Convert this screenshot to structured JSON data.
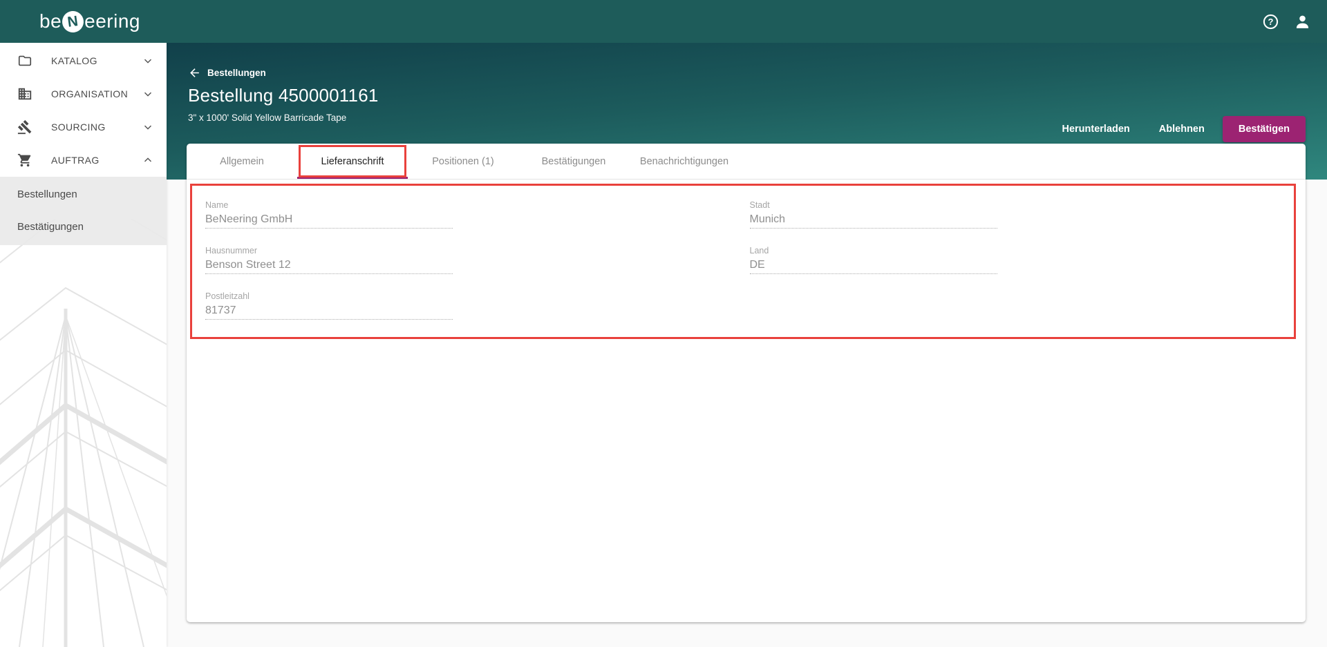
{
  "brand": {
    "logo_before": "be",
    "logo_badge": "N",
    "logo_after": "eering"
  },
  "topbar": {
    "icons": [
      "help-icon",
      "account-icon"
    ]
  },
  "sidebar": {
    "items": [
      {
        "label": "KATALOG",
        "icon": "folder-icon",
        "chevron": "down",
        "expanded": false
      },
      {
        "label": "ORGANISATION",
        "icon": "building-icon",
        "chevron": "down",
        "expanded": false
      },
      {
        "label": "SOURCING",
        "icon": "gavel-icon",
        "chevron": "down",
        "expanded": false
      },
      {
        "label": "AUFTRAG",
        "icon": "cart-icon",
        "chevron": "up",
        "expanded": true
      }
    ],
    "subitems": [
      {
        "label": "Bestellungen",
        "active": true
      },
      {
        "label": "Bestätigungen",
        "active": false
      }
    ]
  },
  "header": {
    "back_label": "Bestellungen",
    "title": "Bestellung 4500001161",
    "subtitle": "3\" x 1000' Solid Yellow Barricade Tape",
    "actions": [
      {
        "label": "Herunterladen",
        "style": "text"
      },
      {
        "label": "Ablehnen",
        "style": "text"
      },
      {
        "label": "Bestätigen",
        "style": "filled"
      }
    ]
  },
  "tabs": [
    {
      "label": "Allgemein",
      "active": false
    },
    {
      "label": "Lieferanschrift",
      "active": true,
      "annotated": true
    },
    {
      "label": "Positionen (1)",
      "active": false
    },
    {
      "label": "Bestätigungen",
      "active": false
    },
    {
      "label": "Benachrichtigungen",
      "active": false
    }
  ],
  "form": {
    "fields": [
      {
        "label": "Name",
        "value": "BeNeering GmbH"
      },
      {
        "label": "Stadt",
        "value": "Munich"
      },
      {
        "label": "Hausnummer",
        "value": "Benson Street 12"
      },
      {
        "label": "Land",
        "value": "DE"
      },
      {
        "label": "Postleitzahl",
        "value": "81737"
      }
    ]
  },
  "colors": {
    "topbar_teal": "#1E5C5A",
    "hero_gradient_top": "#11404A",
    "hero_gradient_bottom": "#2F877E",
    "accent_magenta": "#9C2372",
    "annotation_red": "#E9413C",
    "content_background": "#FAFAFA"
  }
}
